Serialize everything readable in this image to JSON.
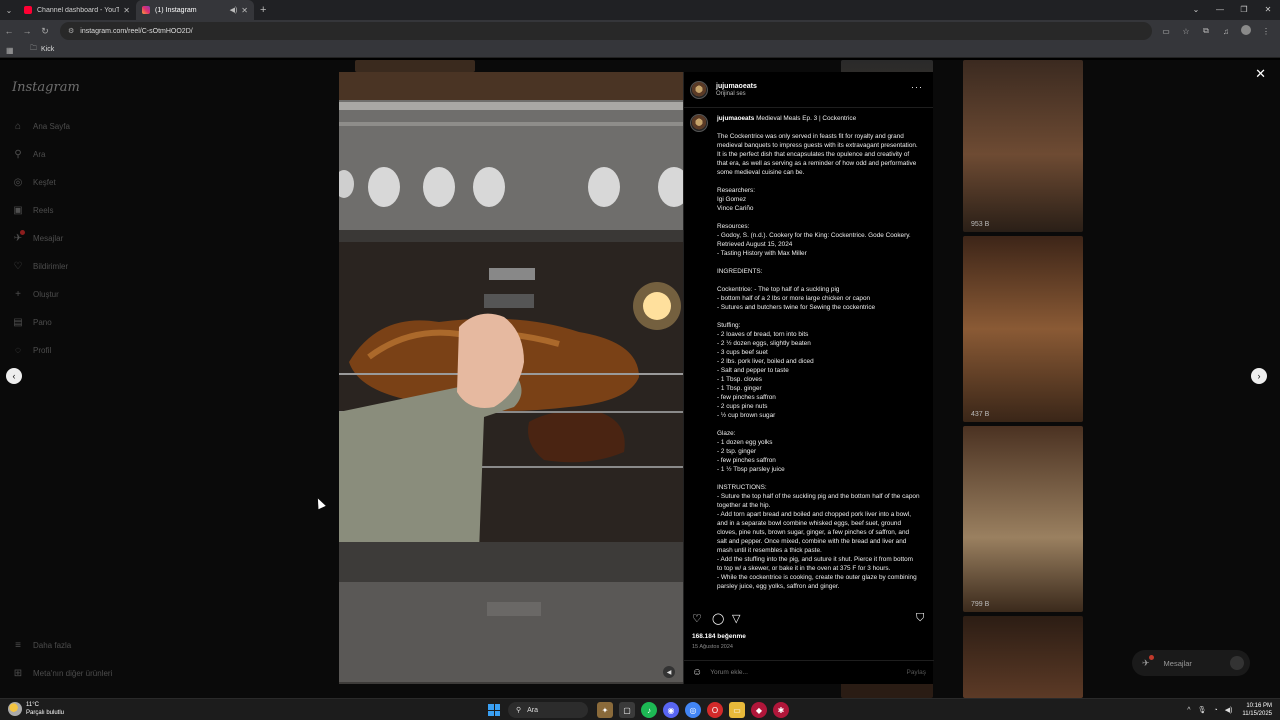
{
  "browser": {
    "tabs": [
      {
        "title": "Channel dashboard - YouTube",
        "favicon_color": "#ff0033"
      },
      {
        "title": "(1) Instagram",
        "favicon_color": "#e1306c"
      }
    ],
    "url": "instagram.com/reel/C-sOtmHOO2D/",
    "bookmarks": [
      {
        "label": "Kick"
      }
    ]
  },
  "sidebar": {
    "logo": "Instagram",
    "items": [
      {
        "label": "Ana Sayfa",
        "icon": "home-icon"
      },
      {
        "label": "Ara",
        "icon": "search-icon"
      },
      {
        "label": "Keşfet",
        "icon": "compass-icon"
      },
      {
        "label": "Reels",
        "icon": "reels-icon"
      },
      {
        "label": "Mesajlar",
        "icon": "messenger-icon"
      },
      {
        "label": "Bildirimler",
        "icon": "heart-icon"
      },
      {
        "label": "Oluştur",
        "icon": "plus-icon"
      },
      {
        "label": "Pano",
        "icon": "dashboard-icon"
      },
      {
        "label": "Profil",
        "icon": "profile-icon"
      }
    ],
    "bottom": [
      {
        "label": "Daha fazla",
        "icon": "menu-icon"
      },
      {
        "label": "Meta'nın diğer ürünleri",
        "icon": "meta-icon"
      }
    ]
  },
  "background_thumbs": [
    {
      "views": "953 B"
    },
    {
      "views": "437 B"
    },
    {
      "views": "799 B"
    }
  ],
  "post": {
    "username": "jujumaoeats",
    "audio": "Orijinal ses",
    "caption_title": "Medieval Meals Ep. 3 | Cockentrice",
    "caption_body": "The Cockentrice was only served in feasts fit for royalty and grand medieval banquets to impress guests with its extravagant presentation. It is the perfect dish that encapsulates the opulence and creativity of that era, as well as serving as a reminder of how odd and performative some medieval cuisine can be.\n\nResearchers:\nIgi Gomez\nVince Cariño\n\nResources:\n- Godoy, S. (n.d.). Cookery for the King: Cockentrice. Gode Cookery. Retrieved August 15, 2024\n- Tasting History with Max Miller\n\nINGREDIENTS:\n\nCockentrice: - The top half of a suckling pig\n- bottom half of a 2 lbs or more large chicken or capon\n- Sutures and butchers twine for Sewing the cockentrice\n\nStuffing:\n- 2 loaves of bread, torn into bits\n- 2 ½ dozen eggs, slightly beaten\n- 3 cups beef suet\n- 2 lbs. pork liver, boiled and diced\n- Salt and pepper to taste\n- 1 Tbsp. cloves\n- 1 Tbsp. ginger\n- few pinches saffron\n- 2 cups pine nuts\n- ½ cup brown sugar\n\nGlaze:\n- 1 dozen egg yolks\n- 2 tsp. ginger\n- few pinches saffron\n- 1 ½ Tbsp parsley juice\n\nINSTRUCTIONS:\n- Suture the top half of the suckling pig and the bottom half of the capon together at the hip.\n- Add torn apart bread and boiled and chopped pork liver into a bowl, and in a separate bowl combine whisked eggs, beef suet, ground cloves, pine nuts, brown sugar, ginger, a few pinches of saffron, and salt and pepper. Once mixed, combine with the bread and liver and mash until it resembles a thick paste.\n- Add the stuffing into the pig, and suture it shut. Pierce it from bottom to top w/ a skewer, or bake it in the oven at 375 F for 3 hours.\n- While the cockentrice is cooking, create the outer glaze by combining parsley juice, egg yolks, saffron and ginger.",
    "likes": "168.184 beğenme",
    "date": "15 Ağustos 2024",
    "comment_placeholder": "Yorum ekle...",
    "share_label": "Paylaş"
  },
  "messages_pill": {
    "label": "Mesajlar"
  },
  "taskbar": {
    "weather_temp": "11°C",
    "weather_text": "Parçalı bulutlu",
    "search_label": "Ara",
    "time": "10:16 PM",
    "date": "11/15/2025"
  }
}
